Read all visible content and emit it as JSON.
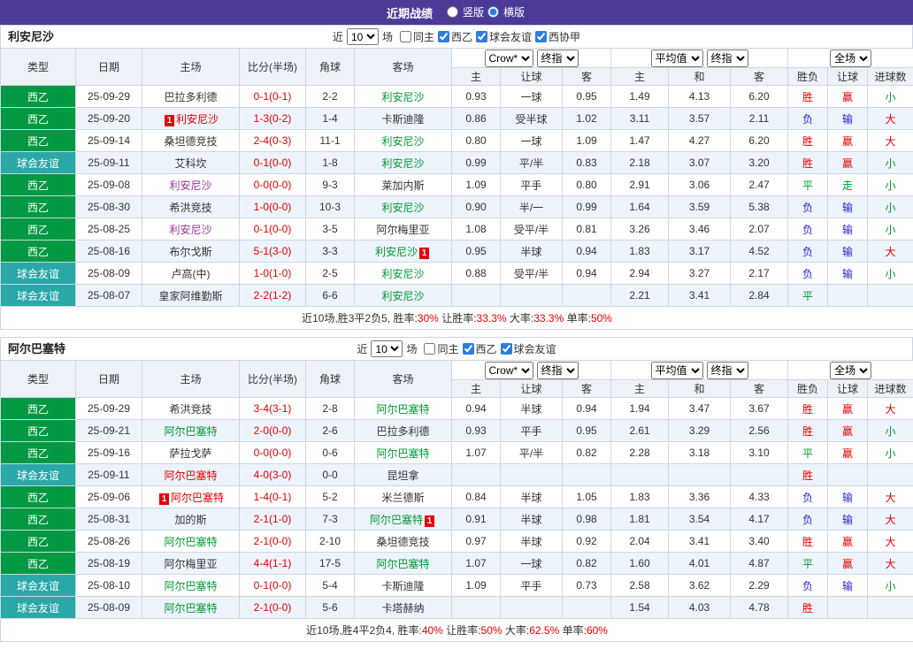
{
  "colors": {
    "topbar": "#4c3a96",
    "league": "#009942",
    "friendly": "#2aa7a7",
    "win_red": "#e60000",
    "draw_green": "#009933",
    "loss_blue": "#2525d0",
    "visited_purple": "#993399"
  },
  "topbar": {
    "title": "近期战绩",
    "modes": [
      {
        "label": "竖版",
        "selected": false
      },
      {
        "label": "横版",
        "selected": true
      }
    ]
  },
  "labels": {
    "near": "近",
    "unit": "场"
  },
  "table": {
    "columns": {
      "type": "类型",
      "date": "日期",
      "home": "主场",
      "score": "比分(半场)",
      "corner": "角球",
      "away": "客场",
      "odds_h": "主",
      "odds_let": "让球",
      "odds_a": "客",
      "avg_h": "主",
      "avg_d": "和",
      "avg_a": "客",
      "res_wdl": "胜负",
      "res_let": "让球",
      "res_goals": "进球数"
    },
    "dropdowns": {
      "provider": "Crow*",
      "final1": "终指",
      "average": "平均值",
      "final2": "终指",
      "scope": "全场"
    }
  },
  "sections": [
    {
      "team": "利安尼沙",
      "filter": {
        "count": "10",
        "checks": [
          {
            "label": "同主",
            "checked": false
          },
          {
            "label": "西乙",
            "checked": true
          },
          {
            "label": "球会友谊",
            "checked": true
          },
          {
            "label": "西协甲",
            "checked": true
          }
        ]
      },
      "rows": [
        {
          "league": "西乙",
          "date": "25-09-29",
          "home": {
            "name": "巴拉多利德",
            "color": "black"
          },
          "score": "0-1(0-1)",
          "corner": "2-2",
          "away": {
            "name": "利安尼沙",
            "color": "green"
          },
          "odds": [
            "0.93",
            "一球",
            "0.95"
          ],
          "avg": [
            "1.49",
            "4.13",
            "6.20"
          ],
          "res": [
            "胜",
            "赢",
            "小"
          ]
        },
        {
          "league": "西乙",
          "date": "25-09-20",
          "home": {
            "name": "利安尼沙",
            "color": "red",
            "badge": {
              "text": "1",
              "pos": "before"
            }
          },
          "score": "1-3(0-2)",
          "corner": "1-4",
          "away": {
            "name": "卡斯迪隆",
            "color": "black"
          },
          "odds": [
            "0.86",
            "受半球",
            "1.02"
          ],
          "avg": [
            "3.11",
            "3.57",
            "2.11"
          ],
          "res": [
            "负",
            "输",
            "大"
          ]
        },
        {
          "league": "西乙",
          "date": "25-09-14",
          "home": {
            "name": "桑坦德竞技",
            "color": "black"
          },
          "score": "2-4(0-3)",
          "corner": "11-1",
          "away": {
            "name": "利安尼沙",
            "color": "green"
          },
          "odds": [
            "0.80",
            "一球",
            "1.09"
          ],
          "avg": [
            "1.47",
            "4.27",
            "6.20"
          ],
          "res": [
            "胜",
            "赢",
            "大"
          ]
        },
        {
          "league": "球会友谊",
          "date": "25-09-11",
          "home": {
            "name": "艾科坎",
            "color": "black"
          },
          "score": "0-1(0-0)",
          "corner": "1-8",
          "away": {
            "name": "利安尼沙",
            "color": "green"
          },
          "odds": [
            "0.99",
            "平/半",
            "0.83"
          ],
          "avg": [
            "2.18",
            "3.07",
            "3.20"
          ],
          "res": [
            "胜",
            "赢",
            "小"
          ]
        },
        {
          "league": "西乙",
          "date": "25-09-08",
          "home": {
            "name": "利安尼沙",
            "color": "purple"
          },
          "score": "0-0(0-0)",
          "corner": "9-3",
          "away": {
            "name": "莱加内斯",
            "color": "black"
          },
          "odds": [
            "1.09",
            "平手",
            "0.80"
          ],
          "avg": [
            "2.91",
            "3.06",
            "2.47"
          ],
          "res": [
            "平",
            "走",
            "小"
          ]
        },
        {
          "league": "西乙",
          "date": "25-08-30",
          "home": {
            "name": "希洪竞技",
            "color": "black"
          },
          "score": "1-0(0-0)",
          "corner": "10-3",
          "away": {
            "name": "利安尼沙",
            "color": "green"
          },
          "odds": [
            "0.90",
            "半/一",
            "0.99"
          ],
          "avg": [
            "1.64",
            "3.59",
            "5.38"
          ],
          "res": [
            "负",
            "输",
            "小"
          ]
        },
        {
          "league": "西乙",
          "date": "25-08-25",
          "home": {
            "name": "利安尼沙",
            "color": "purple"
          },
          "score": "0-1(0-0)",
          "corner": "3-5",
          "away": {
            "name": "阿尔梅里亚",
            "color": "black"
          },
          "odds": [
            "1.08",
            "受平/半",
            "0.81"
          ],
          "avg": [
            "3.26",
            "3.46",
            "2.07"
          ],
          "res": [
            "负",
            "输",
            "小"
          ]
        },
        {
          "league": "西乙",
          "date": "25-08-16",
          "home": {
            "name": "布尔戈斯",
            "color": "black"
          },
          "score": "5-1(3-0)",
          "corner": "3-3",
          "away": {
            "name": "利安尼沙",
            "color": "green",
            "badge": {
              "text": "1",
              "pos": "after"
            }
          },
          "odds": [
            "0.95",
            "半球",
            "0.94"
          ],
          "avg": [
            "1.83",
            "3.17",
            "4.52"
          ],
          "res": [
            "负",
            "输",
            "大"
          ]
        },
        {
          "league": "球会友谊",
          "date": "25-08-09",
          "home": {
            "name": "卢高(中)",
            "color": "black"
          },
          "score": "1-0(1-0)",
          "corner": "2-5",
          "away": {
            "name": "利安尼沙",
            "color": "green"
          },
          "odds": [
            "0.88",
            "受平/半",
            "0.94"
          ],
          "avg": [
            "2.94",
            "3.27",
            "2.17"
          ],
          "res": [
            "负",
            "输",
            "小"
          ]
        },
        {
          "league": "球会友谊",
          "date": "25-08-07",
          "home": {
            "name": "皇家阿维勤斯",
            "color": "black"
          },
          "score": "2-2(1-2)",
          "corner": "6-6",
          "away": {
            "name": "利安尼沙",
            "color": "green"
          },
          "odds": [
            "",
            "",
            ""
          ],
          "avg": [
            "2.21",
            "3.41",
            "2.84"
          ],
          "res": [
            "平",
            "",
            ""
          ]
        }
      ],
      "summary": [
        {
          "text": "近10场,胜3平2负5, 胜率:",
          "color": "dark"
        },
        {
          "text": "30%",
          "color": "red"
        },
        {
          "text": " 让胜率:",
          "color": "dark"
        },
        {
          "text": "33.3%",
          "color": "red"
        },
        {
          "text": " 大率:",
          "color": "dark"
        },
        {
          "text": "33.3%",
          "color": "red"
        },
        {
          "text": " 单率:",
          "color": "dark"
        },
        {
          "text": "50%",
          "color": "red"
        }
      ]
    },
    {
      "team": "阿尔巴塞特",
      "filter": {
        "count": "10",
        "checks": [
          {
            "label": "同主",
            "checked": false
          },
          {
            "label": "西乙",
            "checked": true
          },
          {
            "label": "球会友谊",
            "checked": true
          }
        ]
      },
      "rows": [
        {
          "league": "西乙",
          "date": "25-09-29",
          "home": {
            "name": "希洪竞技",
            "color": "black"
          },
          "score": "3-4(3-1)",
          "corner": "2-8",
          "away": {
            "name": "阿尔巴塞特",
            "color": "green"
          },
          "odds": [
            "0.94",
            "半球",
            "0.94"
          ],
          "avg": [
            "1.94",
            "3.47",
            "3.67"
          ],
          "res": [
            "胜",
            "赢",
            "大"
          ]
        },
        {
          "league": "西乙",
          "date": "25-09-21",
          "home": {
            "name": "阿尔巴塞特",
            "color": "green"
          },
          "score": "2-0(0-0)",
          "corner": "2-6",
          "away": {
            "name": "巴拉多利德",
            "color": "black"
          },
          "odds": [
            "0.93",
            "平手",
            "0.95"
          ],
          "avg": [
            "2.61",
            "3.29",
            "2.56"
          ],
          "res": [
            "胜",
            "赢",
            "小"
          ]
        },
        {
          "league": "西乙",
          "date": "25-09-16",
          "home": {
            "name": "萨拉戈萨",
            "color": "black"
          },
          "score": "0-0(0-0)",
          "corner": "0-6",
          "away": {
            "name": "阿尔巴塞特",
            "color": "green"
          },
          "odds": [
            "1.07",
            "平/半",
            "0.82"
          ],
          "avg": [
            "2.28",
            "3.18",
            "3.10"
          ],
          "res": [
            "平",
            "赢",
            "小"
          ]
        },
        {
          "league": "球会友谊",
          "date": "25-09-11",
          "home": {
            "name": "阿尔巴塞特",
            "color": "red"
          },
          "score": "4-0(3-0)",
          "corner": "0-0",
          "away": {
            "name": "昆坦拿",
            "color": "black"
          },
          "odds": [
            "",
            "",
            ""
          ],
          "avg": [
            "",
            "",
            ""
          ],
          "res": [
            "胜",
            "",
            ""
          ]
        },
        {
          "league": "西乙",
          "date": "25-09-06",
          "home": {
            "name": "阿尔巴塞特",
            "color": "red",
            "badge": {
              "text": "1",
              "pos": "before"
            }
          },
          "score": "1-4(0-1)",
          "corner": "5-2",
          "away": {
            "name": "米兰德斯",
            "color": "black"
          },
          "odds": [
            "0.84",
            "半球",
            "1.05"
          ],
          "avg": [
            "1.83",
            "3.36",
            "4.33"
          ],
          "res": [
            "负",
            "输",
            "大"
          ]
        },
        {
          "league": "西乙",
          "date": "25-08-31",
          "home": {
            "name": "加的斯",
            "color": "black"
          },
          "score": "2-1(1-0)",
          "corner": "7-3",
          "away": {
            "name": "阿尔巴塞特",
            "color": "green",
            "badge": {
              "text": "1",
              "pos": "after"
            }
          },
          "odds": [
            "0.91",
            "半球",
            "0.98"
          ],
          "avg": [
            "1.81",
            "3.54",
            "4.17"
          ],
          "res": [
            "负",
            "输",
            "大"
          ]
        },
        {
          "league": "西乙",
          "date": "25-08-26",
          "home": {
            "name": "阿尔巴塞特",
            "color": "green"
          },
          "score": "2-1(0-0)",
          "corner": "2-10",
          "away": {
            "name": "桑坦德竞技",
            "color": "black"
          },
          "odds": [
            "0.97",
            "半球",
            "0.92"
          ],
          "avg": [
            "2.04",
            "3.41",
            "3.40"
          ],
          "res": [
            "胜",
            "赢",
            "大"
          ]
        },
        {
          "league": "西乙",
          "date": "25-08-19",
          "home": {
            "name": "阿尔梅里亚",
            "color": "black"
          },
          "score": "4-4(1-1)",
          "corner": "17-5",
          "away": {
            "name": "阿尔巴塞特",
            "color": "green"
          },
          "odds": [
            "1.07",
            "一球",
            "0.82"
          ],
          "avg": [
            "1.60",
            "4.01",
            "4.87"
          ],
          "res": [
            "平",
            "赢",
            "大"
          ]
        },
        {
          "league": "球会友谊",
          "date": "25-08-10",
          "home": {
            "name": "阿尔巴塞特",
            "color": "green"
          },
          "score": "0-1(0-0)",
          "corner": "5-4",
          "away": {
            "name": "卡斯迪隆",
            "color": "black"
          },
          "odds": [
            "1.09",
            "平手",
            "0.73"
          ],
          "avg": [
            "2.58",
            "3.62",
            "2.29"
          ],
          "res": [
            "负",
            "输",
            "小"
          ]
        },
        {
          "league": "球会友谊",
          "date": "25-08-09",
          "home": {
            "name": "阿尔巴塞特",
            "color": "green"
          },
          "score": "2-1(0-0)",
          "corner": "5-6",
          "away": {
            "name": "卡塔赫纳",
            "color": "black"
          },
          "odds": [
            "",
            "",
            ""
          ],
          "avg": [
            "1.54",
            "4.03",
            "4.78"
          ],
          "res": [
            "胜",
            "",
            ""
          ]
        }
      ],
      "summary": [
        {
          "text": "近10场,胜4平2负4, 胜率:",
          "color": "dark"
        },
        {
          "text": "40%",
          "color": "red"
        },
        {
          "text": " 让胜率:",
          "color": "dark"
        },
        {
          "text": "50%",
          "color": "red"
        },
        {
          "text": " 大率:",
          "color": "dark"
        },
        {
          "text": "62.5%",
          "color": "red"
        },
        {
          "text": " 单率:",
          "color": "dark"
        },
        {
          "text": "60%",
          "color": "red"
        }
      ]
    }
  ]
}
